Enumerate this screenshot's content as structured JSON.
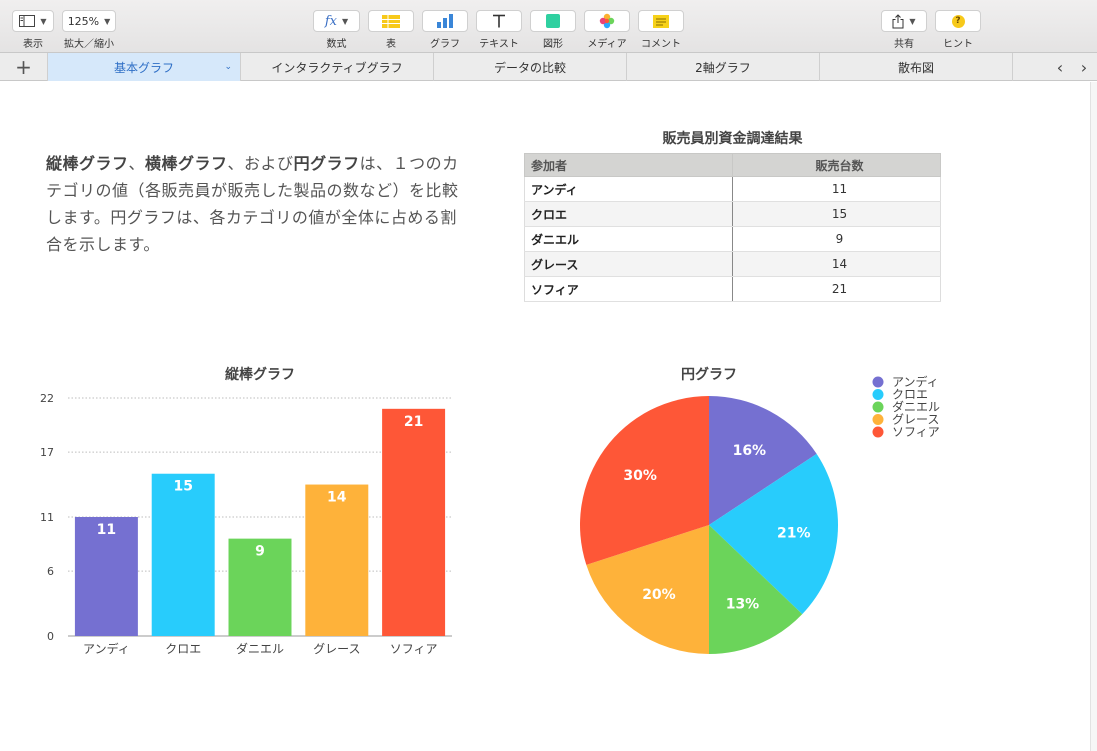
{
  "toolbar": {
    "view_label": "表示",
    "zoom_value": "125%",
    "zoom_label": "拡大／縮小",
    "formula_symbol": "fx",
    "formula_label": "数式",
    "table_label": "表",
    "chart_label": "グラフ",
    "text_label": "テキスト",
    "shape_label": "図形",
    "media_label": "メディア",
    "comment_label": "コメント",
    "share_label": "共有",
    "tips_label": "ヒント",
    "tips_symbol": "?",
    "icons": [
      "sidebar-view-icon",
      "fx-icon",
      "table-icon",
      "chart-icon",
      "text-icon",
      "shape-icon",
      "media-icon",
      "comment-icon",
      "share-icon",
      "tips-icon"
    ]
  },
  "tabs": [
    {
      "label": "基本グラフ",
      "active": true
    },
    {
      "label": "インタラクティブグラフ",
      "active": false
    },
    {
      "label": "データの比較",
      "active": false
    },
    {
      "label": "2軸グラフ",
      "active": false
    },
    {
      "label": "散布図",
      "active": false
    }
  ],
  "tabbar": {
    "add_symbol": "+",
    "prev_symbol": "‹",
    "next_symbol": "›"
  },
  "intro": {
    "bold1": "縦棒グラフ",
    "sep1": "、",
    "bold2": "横棒グラフ",
    "mid": "、および",
    "bold3": "円グラフ",
    "rest": "は、１つのカテゴリの値（各販売員が販売した製品の数など）を比較します。円グラフは、各カテゴリの値が全体に占める割合を示します。"
  },
  "table": {
    "title": "販売員別資金調達結果",
    "headers": [
      "参加者",
      "販売台数"
    ],
    "rows": [
      {
        "name": "アンディ",
        "value": "11"
      },
      {
        "name": "クロエ",
        "value": "15"
      },
      {
        "name": "ダニエル",
        "value": "9"
      },
      {
        "name": "グレース",
        "value": "14"
      },
      {
        "name": "ソフィア",
        "value": "21"
      }
    ]
  },
  "colors": {
    "series": [
      "#7570d1",
      "#28ccfc",
      "#6bd45a",
      "#feb23a",
      "#fe5737"
    ],
    "accent": "#2f6fc6"
  },
  "chart_data": [
    {
      "type": "bar",
      "title": "縦棒グラフ",
      "categories": [
        "アンディ",
        "クロエ",
        "ダニエル",
        "グレース",
        "ソフィア"
      ],
      "values": [
        11,
        15,
        9,
        14,
        21
      ],
      "ylim": [
        0,
        22
      ],
      "yticks": [
        "0",
        "6",
        "11",
        "17",
        "22"
      ],
      "grid": true,
      "xlabel": "",
      "ylabel": ""
    },
    {
      "type": "pie",
      "title": "円グラフ",
      "categories": [
        "アンディ",
        "クロエ",
        "ダニエル",
        "グレース",
        "ソフィア"
      ],
      "values": [
        11,
        15,
        9,
        14,
        21
      ],
      "percent_labels": [
        "16%",
        "21%",
        "13%",
        "20%",
        "30%"
      ],
      "legend": "top-right"
    }
  ]
}
